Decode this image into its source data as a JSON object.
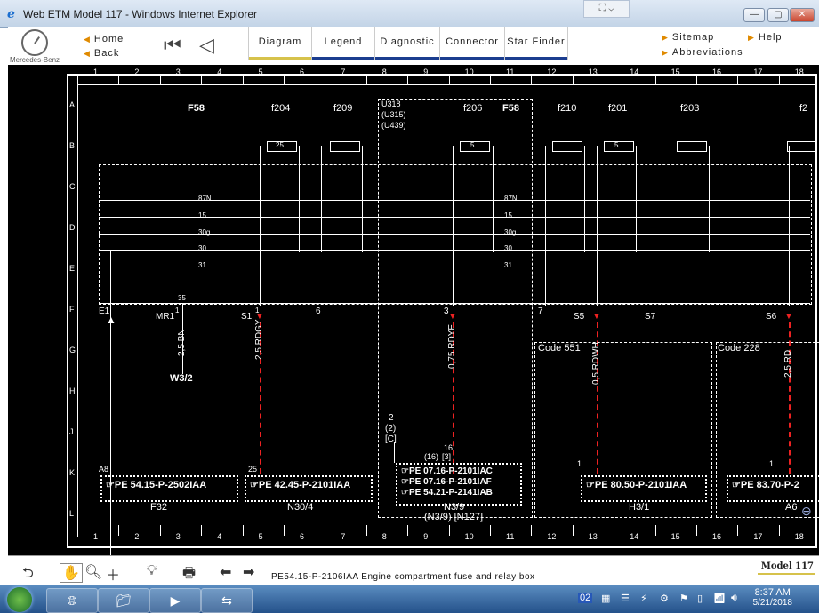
{
  "window": {
    "title": "Web ETM Model 117 - Windows Internet Explorer",
    "min": "—",
    "max": "▢",
    "close": "✕",
    "compat": "⛶ ⌄"
  },
  "toolbar": {
    "logo_text": "Mercedes-Benz",
    "home": "Home",
    "back": "Back",
    "tabs": [
      "Diagram",
      "Legend",
      "Diagnostic",
      "Connector",
      "Star Finder"
    ],
    "sitemap": "Sitemap",
    "abbreviations": "Abbreviations",
    "help": "Help"
  },
  "diagram": {
    "col_numbers": [
      "1",
      "2",
      "3",
      "4",
      "5",
      "6",
      "7",
      "8",
      "9",
      "10",
      "11",
      "12",
      "13",
      "14",
      "15",
      "16",
      "17",
      "18"
    ],
    "row_letters": [
      "A",
      "B",
      "C",
      "D",
      "E",
      "F",
      "G",
      "H",
      "J",
      "K",
      "L"
    ],
    "top_labels": [
      "F58",
      "f204",
      "f209",
      "f206",
      "F58",
      "f210",
      "f201",
      "f203",
      "f2"
    ],
    "u_codes": [
      "U318",
      "(U315)",
      "(U439)"
    ],
    "bus_labels": [
      "87N",
      "15",
      "30g",
      "30",
      "31"
    ],
    "bus_labels_right": [
      "87N",
      "15",
      "30g",
      "30",
      "31"
    ],
    "fuse_values": [
      "25",
      "5",
      "5"
    ],
    "terminals": [
      "E1",
      "MR1",
      "S1",
      "6",
      "3",
      "7",
      "S5",
      "S7",
      "S6"
    ],
    "terminal_nums": [
      "35",
      "1",
      "3",
      "1",
      "1"
    ],
    "wires": [
      "2,5 BN",
      "2,5 RDGY",
      "0,75 RDYE",
      "0,5 RDWH",
      "2,5 RD"
    ],
    "w_label": "W3/2",
    "code_boxes": [
      "Code 551",
      "Code 228"
    ],
    "pe_boxes": [
      {
        "text": "☞PE 54.15-P-2502IAA",
        "caption": "F32",
        "pin": "A8"
      },
      {
        "text": "☞PE 42.45-P-2101IAA",
        "caption": "N30/4",
        "pin": "25"
      },
      {
        "text": "☞PE 07.16-P-2101IAC\n☞PE 07.16-P-2101IAF\n☞PE 54.21-P-2141IAB",
        "caption": "N3/9",
        "caption2": "(N3/9) [N127]",
        "pin": "16"
      },
      {
        "text": "☞PE 80.50-P-2101IAA",
        "caption": "H3/1",
        "pin": "1"
      },
      {
        "text": "☞PE 83.70-P-2",
        "caption": "A6",
        "pin": "1"
      }
    ],
    "mid_labels": [
      "2",
      "(2)",
      "[C]",
      "(16)",
      "[3]"
    ]
  },
  "bottombar": {
    "status": "PE54.15-P-2106IAA   Engine compartment fuse and relay box",
    "model": "Model 117"
  },
  "taskbar": {
    "time": "8:37 AM",
    "date": "5/21/2018",
    "lang": "02"
  }
}
